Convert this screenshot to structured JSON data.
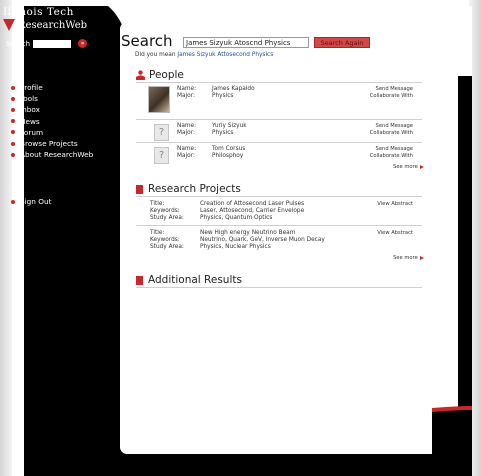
{
  "brand": {
    "line1": "Illinois Tech",
    "line2": "ResearchWeb"
  },
  "sidebar": {
    "search_label": "Search",
    "search_value": "",
    "go_label": "»",
    "items": [
      {
        "label": "Profile"
      },
      {
        "label": "Tools"
      },
      {
        "label": "Inbox"
      },
      {
        "label": "News"
      },
      {
        "label": "Forum"
      },
      {
        "label": "Browse Projects"
      },
      {
        "label": "About ResearchWeb"
      }
    ],
    "signout_label": "Sign Out"
  },
  "search": {
    "title": "Search",
    "query": "James Sizyuk Atoscnd Physics",
    "button_label": "Search Again",
    "did_you_mean_prefix": "Did you mean",
    "did_you_mean_suggestion": "James Sizyuk Attosecond Physics"
  },
  "people": {
    "heading": "People",
    "name_label": "Name:",
    "major_label": "Major:",
    "send_message_label": "Send Message",
    "collaborate_label": "Collaborate With",
    "placeholder_glyph": "?",
    "see_more_label": "See more",
    "entries": [
      {
        "name": "James Kapaldo",
        "major": "Physics"
      },
      {
        "name": "Yuriy Sizyuk",
        "major": "Physics"
      },
      {
        "name": "Tom Corsus",
        "major": "Philosphoy"
      }
    ]
  },
  "projects": {
    "heading": "Research Projects",
    "title_label": "Title:",
    "keywords_label": "Keywords:",
    "study_label": "Study Area:",
    "view_abstract_label": "View Abstract",
    "see_more_label": "See more",
    "entries": [
      {
        "title": "Creation of Attosecond Laser Pulses",
        "keywords": "Laser, Attosecond, Carrier Envelope",
        "study_area": "Physics, Quantum Optics"
      },
      {
        "title": "New High energy Neutrino Beam",
        "keywords": "Neutrino, Quark, GeV, Inverse Muon Decay",
        "study_area": "Physics, Nuclear Physics"
      }
    ]
  },
  "additional": {
    "heading": "Additional Results"
  },
  "icons": {
    "logo_triangle": "triangle-icon",
    "section_bar": "red-bar-icon",
    "people_section": "people-icon",
    "nav_bullet": "dot-icon",
    "see_more": "arrow-right-icon"
  },
  "colors": {
    "accent": "#c8282c",
    "button": "#d24848",
    "link": "#2a4a9a",
    "background": "#000000",
    "content": "#ffffff"
  }
}
